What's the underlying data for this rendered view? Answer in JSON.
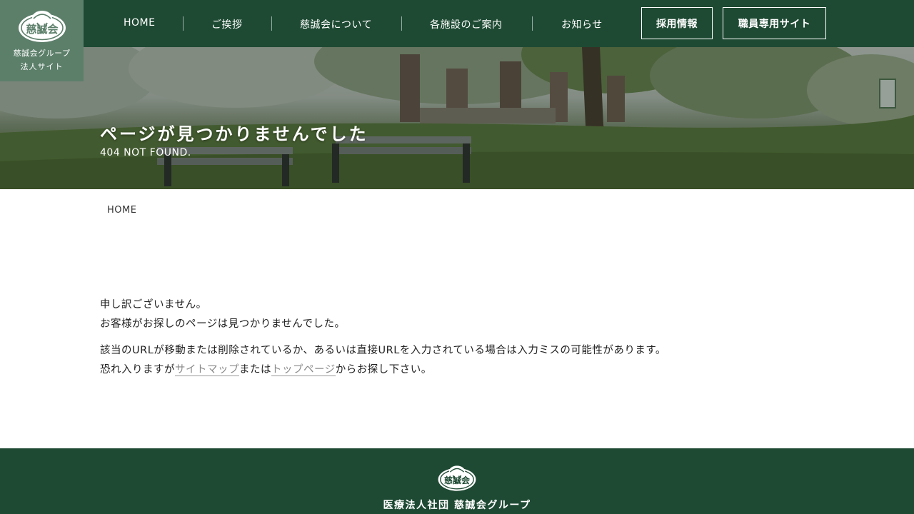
{
  "header": {
    "logo": {
      "line1": "慈誠会グループ",
      "line2": "法人サイト",
      "mark_text": "慈誠会"
    },
    "nav": [
      {
        "label": "HOME"
      },
      {
        "label": "ご挨拶"
      },
      {
        "label": "慈誠会について"
      },
      {
        "label": "各施設のご案内"
      },
      {
        "label": "お知らせ"
      }
    ],
    "buttons": {
      "recruit": "採用情報",
      "staff": "職員専用サイト"
    }
  },
  "hero": {
    "title": "ページが見つかりませんでした",
    "subtitle": "404 NOT FOUND."
  },
  "breadcrumb": {
    "home": "HOME"
  },
  "message": {
    "line1": "申し訳ございません。",
    "line2": "お客様がお探しのページは見つかりませんでした。",
    "line3": "該当のURLが移動または削除されているか、あるいは直接URLを入力されている場合は入力ミスの可能性があります。",
    "line4_pre": "恐れ入りますが",
    "sitemap_link": "サイトマップ",
    "line4_mid": "または",
    "top_link": "トップページ",
    "line4_post": "からお探し下さい。"
  },
  "footer": {
    "org_name": "医療法人社団 慈誠会グループ"
  },
  "colors": {
    "primary": "#1e4a33",
    "logo_bg": "#5c7f6a",
    "link": "#8a8a8a"
  }
}
